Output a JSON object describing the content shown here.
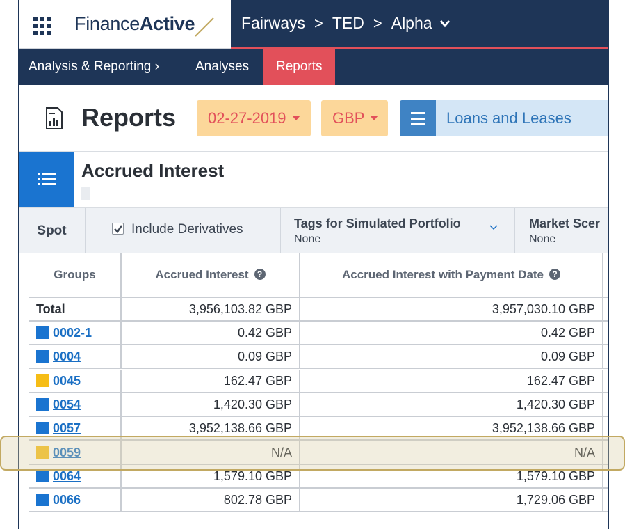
{
  "logo": {
    "text_regular": "Finance",
    "text_bold": "Active"
  },
  "breadcrumbs": [
    "Fairways",
    "TED",
    "Alpha"
  ],
  "nav": {
    "items": [
      "Analysis & Reporting",
      "Analyses",
      "Reports"
    ],
    "active": "Reports",
    "analysis_suffix": "›"
  },
  "page": {
    "title": "Reports",
    "date": "02-27-2019",
    "currency": "GBP",
    "scope": "Loans and Leases"
  },
  "report": {
    "title": "Accrued Interest"
  },
  "options": {
    "spot": "Spot",
    "include_derivatives": "Include Derivatives",
    "include_derivatives_checked": true,
    "tags_title": "Tags for Simulated Portfolio",
    "tags_value": "None",
    "market_title": "Market Scer",
    "market_value": "None"
  },
  "table": {
    "headers": [
      "Groups",
      "Accrued Interest",
      "Accrued Interest with Payment Date"
    ],
    "total": {
      "label": "Total",
      "ai": "3,956,103.82 GBP",
      "aipd": "3,957,030.10 GBP"
    },
    "rows": [
      {
        "group": "0002-1",
        "color": "#1a74d0",
        "ai": "0.42 GBP",
        "aipd": "0.42 GBP"
      },
      {
        "group": "0004",
        "color": "#1a74d0",
        "ai": "0.09 GBP",
        "aipd": "0.09 GBP"
      },
      {
        "group": "0045",
        "color": "#f6bd16",
        "ai": "162.47 GBP",
        "aipd": "162.47 GBP"
      },
      {
        "group": "0054",
        "color": "#1a74d0",
        "ai": "1,420.30 GBP",
        "aipd": "1,420.30 GBP"
      },
      {
        "group": "0057",
        "color": "#1a74d0",
        "ai": "3,952,138.66 GBP",
        "aipd": "3,952,138.66 GBP"
      },
      {
        "group": "0059",
        "color": "#f6bd16",
        "ai": "N/A",
        "aipd": "N/A"
      },
      {
        "group": "0064",
        "color": "#1a74d0",
        "ai": "1,579.10 GBP",
        "aipd": "1,579.10 GBP"
      },
      {
        "group": "0066",
        "color": "#1a74d0",
        "ai": "802.78 GBP",
        "aipd": "1,729.06 GBP"
      }
    ]
  }
}
